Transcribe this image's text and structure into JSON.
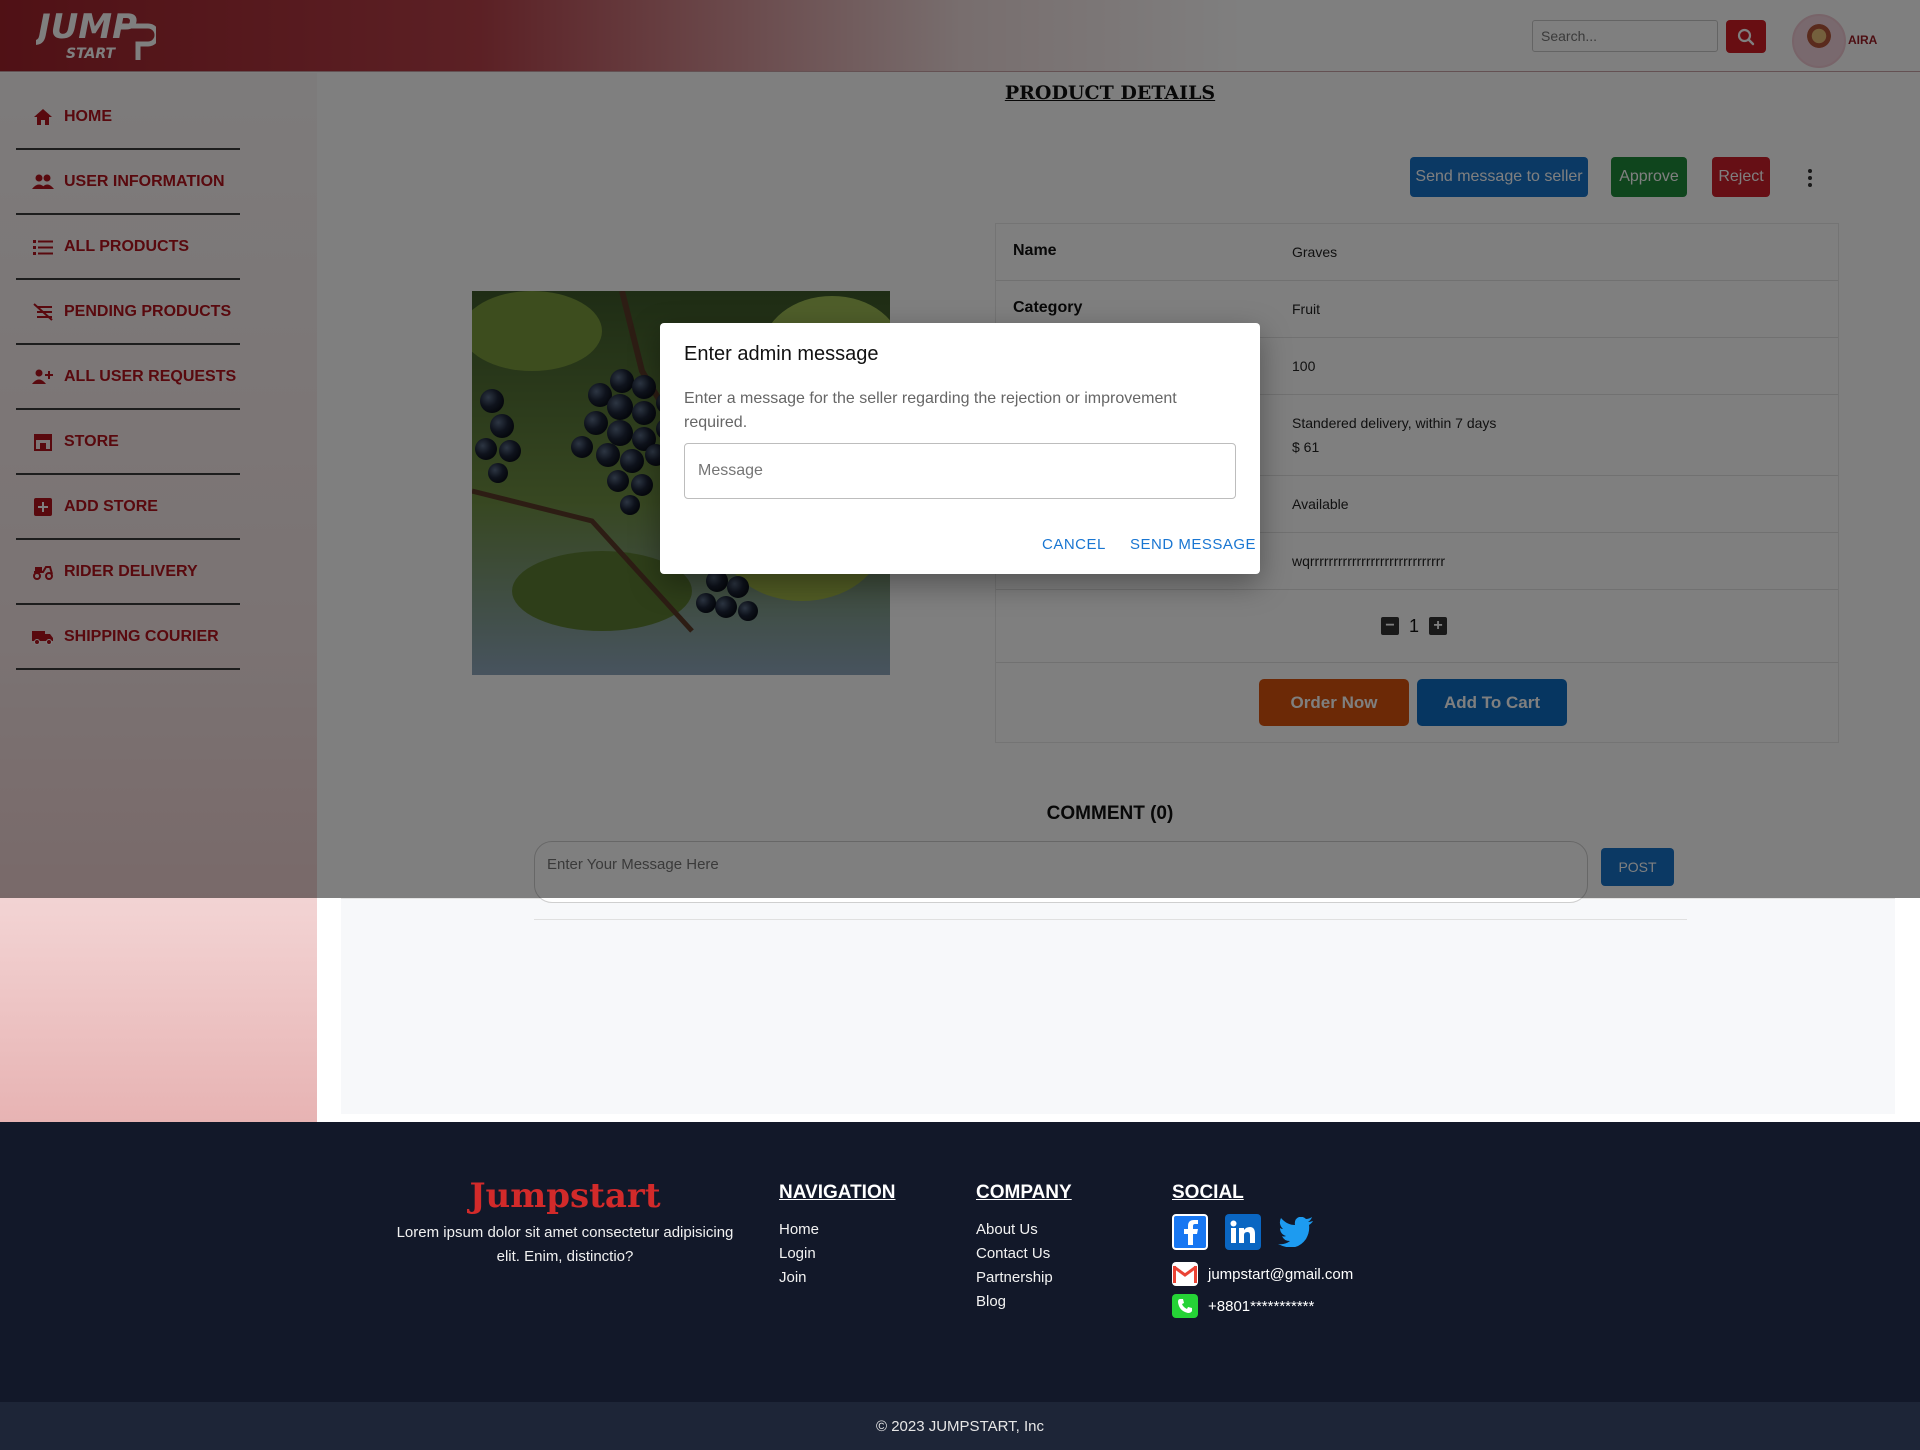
{
  "header": {
    "logo_top": "JUMP",
    "logo_bottom": "START",
    "search_placeholder": "Search...",
    "user_name": "AIRA"
  },
  "sidebar": {
    "items": [
      {
        "label": "HOME",
        "icon": "home-icon"
      },
      {
        "label": "USER INFORMATION",
        "icon": "users-icon"
      },
      {
        "label": "ALL PRODUCTS",
        "icon": "list-icon"
      },
      {
        "label": "PENDING PRODUCTS",
        "icon": "pending-icon"
      },
      {
        "label": "ALL USER REQUESTS",
        "icon": "user-request-icon"
      },
      {
        "label": "STORE",
        "icon": "store-icon"
      },
      {
        "label": "ADD STORE",
        "icon": "add-store-icon"
      },
      {
        "label": "RIDER DELIVERY",
        "icon": "moped-icon"
      },
      {
        "label": "SHIPPING COURIER",
        "icon": "truck-icon"
      }
    ]
  },
  "page": {
    "title": "PRODUCT DETAILS",
    "actions": {
      "send_message": "Send message to seller",
      "approve": "Approve",
      "reject": "Reject"
    }
  },
  "product": {
    "rows": [
      {
        "key": "Name",
        "value": "Graves"
      },
      {
        "key": "Category",
        "value": "Fruit"
      },
      {
        "key": "",
        "value": "100"
      },
      {
        "key": "",
        "value": "Standered delivery, within 7 days",
        "value2": "$ 61"
      },
      {
        "key": "",
        "value": "Available"
      },
      {
        "key": "",
        "value": "wqrrrrrrrrrrrrrrrrrrrrrrrrrrrrr"
      }
    ],
    "quantity": "1",
    "order_now": "Order Now",
    "add_to_cart": "Add To Cart"
  },
  "comments": {
    "title": "COMMENT (0)",
    "placeholder": "Enter Your Message Here",
    "post": "POST"
  },
  "modal": {
    "title": "Enter admin message",
    "text": "Enter a message for the seller regarding the rejection or improvement required.",
    "placeholder": "Message",
    "cancel": "CANCEL",
    "send": "SEND MESSAGE"
  },
  "footer": {
    "brand": "Jumpstart",
    "description": "Lorem ipsum dolor sit amet consectetur adipisicing elit. Enim, distinctio?",
    "navigation": {
      "title": "NAVIGATION",
      "links": [
        "Home",
        "Login",
        "Join"
      ]
    },
    "company": {
      "title": "COMPANY",
      "links": [
        "About Us",
        "Contact Us",
        "Partnership",
        "Blog"
      ]
    },
    "social": {
      "title": "SOCIAL",
      "email": "jumpstart@gmail.com",
      "phone": "+8801***********"
    },
    "copyright": "© 2023 JUMPSTART, Inc"
  },
  "colors": {
    "brand_red": "#b3121c",
    "primary_blue": "#1672c8",
    "approve_green": "#1e8a3a",
    "reject_red": "#cc1f2b",
    "order_orange": "#d8520c",
    "footer_bg": "#121829"
  }
}
